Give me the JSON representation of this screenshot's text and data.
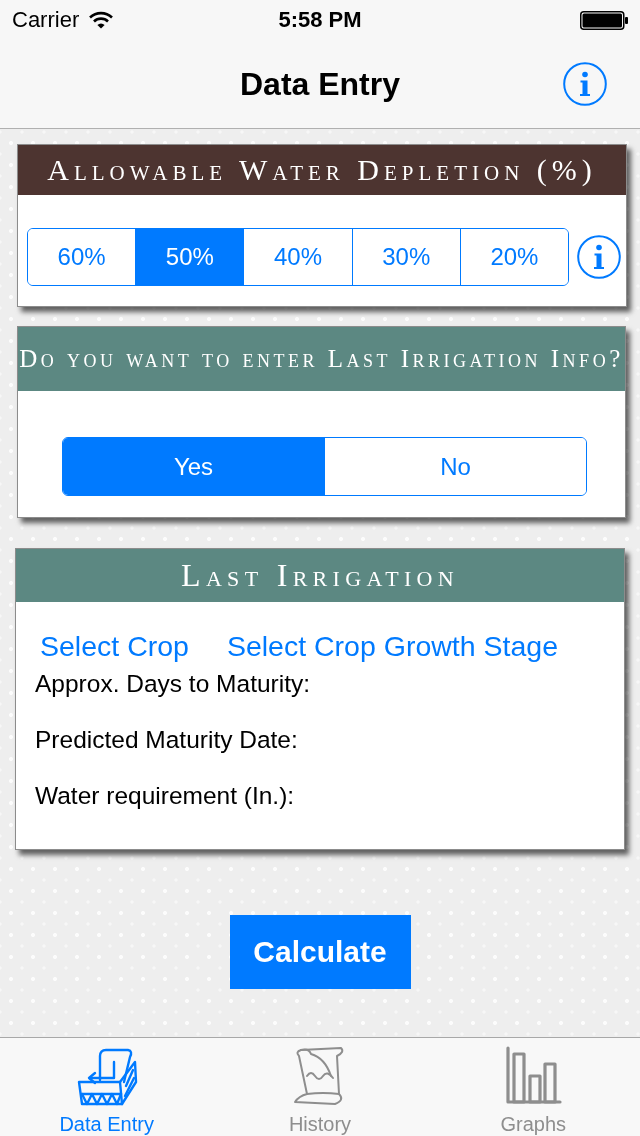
{
  "status_bar": {
    "carrier": "Carrier",
    "time": "5:58 PM"
  },
  "nav_bar": {
    "title": "Data Entry"
  },
  "depletion_card": {
    "title": "Allowable Water Depletion (%)",
    "options": [
      {
        "label": "60%",
        "selected": false
      },
      {
        "label": "50%",
        "selected": true
      },
      {
        "label": "40%",
        "selected": false
      },
      {
        "label": "30%",
        "selected": false
      },
      {
        "label": "20%",
        "selected": false
      }
    ]
  },
  "irrigation_prompt_card": {
    "title": "Do you want to enter Last Irrigation Info?",
    "options": [
      {
        "label": "Yes",
        "selected": true
      },
      {
        "label": "No",
        "selected": false
      }
    ]
  },
  "last_irrigation_card": {
    "title": "Last Irrigation",
    "links": [
      "Select Crop",
      "Select Crop Growth Stage"
    ],
    "fields": [
      "Approx. Days to Maturity:",
      "Predicted Maturity Date:",
      "Water requirement (In.):"
    ]
  },
  "calculate_button": {
    "label": "Calculate"
  },
  "tab_bar": {
    "items": [
      {
        "label": "Data Entry",
        "selected": true
      },
      {
        "label": "History",
        "selected": false
      },
      {
        "label": "Graphs",
        "selected": false
      }
    ]
  }
}
